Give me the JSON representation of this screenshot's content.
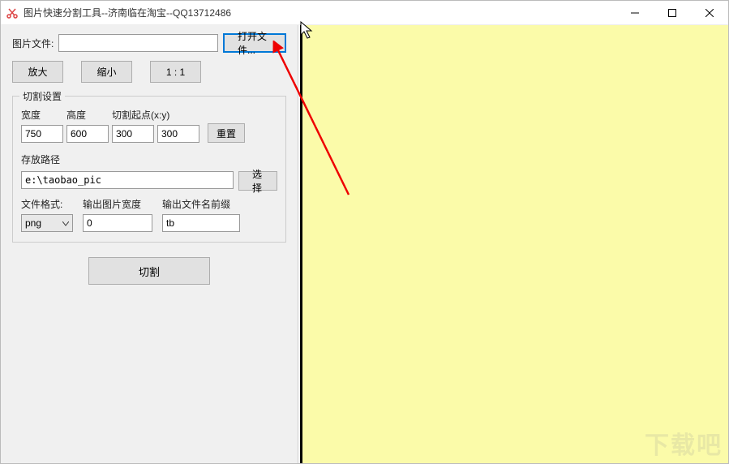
{
  "titlebar": {
    "title": "图片快速分割工具--济南临在淘宝--QQ13712486"
  },
  "toolbar": {
    "file_label": "图片文件:",
    "file_value": "",
    "open_label": "打开文件...",
    "zoom_in": "放大",
    "zoom_out": "缩小",
    "zoom_actual": "1 : 1"
  },
  "cut_group": {
    "title": "切割设置",
    "width_label": "宽度",
    "width_value": "750",
    "height_label": "高度",
    "height_value": "600",
    "origin_label": "切割起点(x:y)",
    "origin_x": "300",
    "origin_y": "300",
    "reset_label": "重置",
    "path_label": "存放路径",
    "path_value": "e:\\taobao_pic",
    "choose_label": "选择",
    "fmt_label": "文件格式:",
    "fmt_value": "png",
    "outw_label": "输出图片宽度",
    "outw_value": "0",
    "prefix_label": "输出文件名前缀",
    "prefix_value": "tb"
  },
  "cut_btn": "切割",
  "watermark": "下载吧"
}
